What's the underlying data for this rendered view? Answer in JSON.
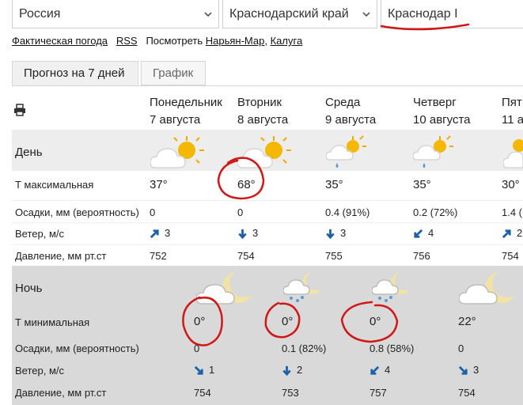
{
  "selects": [
    {
      "value": "Россия"
    },
    {
      "value": "Краснодарский край"
    },
    {
      "value": "Краснодар I"
    }
  ],
  "links": {
    "fact": "Фактическая погода",
    "rss": "RSS",
    "view_label": "Посмотреть",
    "city1": "Нарьян-Мар",
    "comma": ",",
    "city2": "Калуга"
  },
  "tabs": [
    {
      "label": "Прогноз на 7 дней",
      "active": true
    },
    {
      "label": "График",
      "active": false
    }
  ],
  "days": [
    {
      "name": "Понедельник",
      "date": "7 августа"
    },
    {
      "name": "Вторник",
      "date": "8 августа"
    },
    {
      "name": "Среда",
      "date": "9 августа"
    },
    {
      "name": "Четверг",
      "date": "10 августа"
    },
    {
      "name": "Пят",
      "date": "11 а"
    }
  ],
  "day_section": {
    "title": "День",
    "icons": [
      "sun-cloud-icon",
      "sun-cloud-icon",
      "sun-cloud-rain-icon",
      "sun-cloud-rain-icon",
      "sun-cloud-icon"
    ],
    "labels": {
      "tmax": "Т максимальная",
      "precip": "Осадки, мм (вероятность)",
      "wind": "Ветер, м/с",
      "pressure": "Давление, мм рт.ст"
    },
    "tmax": [
      "37°",
      "68°",
      "35°",
      "35°",
      "30°"
    ],
    "precip": [
      "0",
      "0",
      "0.4 (91%)",
      "0.2 (72%)",
      "1.4 ("
    ],
    "wind": [
      {
        "value": "3",
        "dir": "northeast"
      },
      {
        "value": "3",
        "dir": "south"
      },
      {
        "value": "3",
        "dir": "south"
      },
      {
        "value": "4",
        "dir": "southwest"
      },
      {
        "value": "2",
        "dir": "northeast"
      }
    ],
    "pressure": [
      "752",
      "754",
      "755",
      "756",
      "754"
    ]
  },
  "night_section": {
    "title": "Ночь",
    "icons": [
      "moon-cloud-icon",
      "moon-cloud-snow-icon",
      "moon-cloud-snow-icon",
      "moon-cloud-icon"
    ],
    "labels": {
      "tmin": "Т минимальная",
      "precip": "Осадки, мм (вероятность)",
      "wind": "Ветер, м/с",
      "pressure": "Давление, мм рт.ст"
    },
    "tmin": [
      "0°",
      "0°",
      "0°",
      "22°"
    ],
    "precip": [
      "0",
      "0.1 (82%)",
      "0.8 (58%)",
      "0"
    ],
    "wind": [
      {
        "value": "1",
        "dir": "southeast"
      },
      {
        "value": "2",
        "dir": "south"
      },
      {
        "value": "4",
        "dir": "southwest"
      },
      {
        "value": "3",
        "dir": "southeast"
      }
    ],
    "pressure": [
      "754",
      "753",
      "757",
      "754"
    ]
  },
  "colors": {
    "accent": "#1a5fa8",
    "annotation": "#d01818",
    "sun": "#f5b800"
  }
}
